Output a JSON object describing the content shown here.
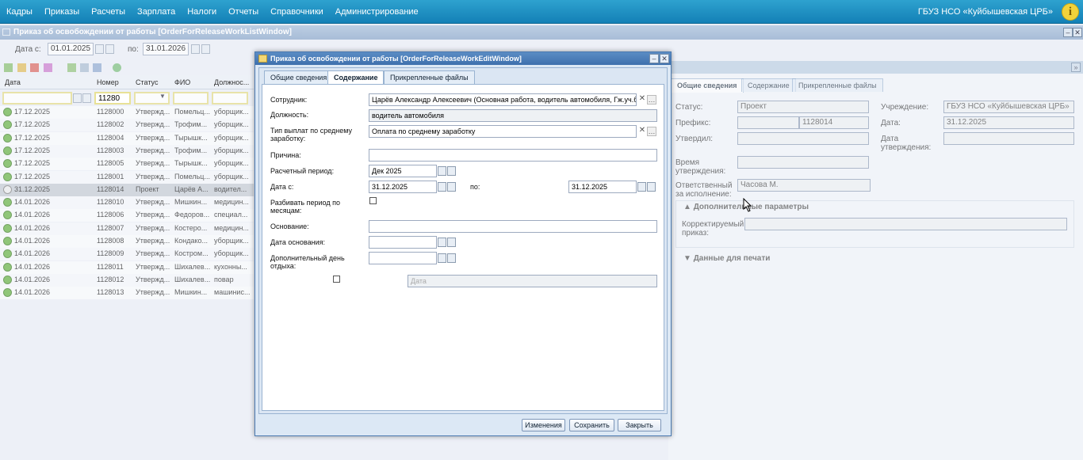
{
  "menu": [
    "Кадры",
    "Приказы",
    "Расчеты",
    "Зарплата",
    "Налоги",
    "Отчеты",
    "Справочники",
    "Администрирование"
  ],
  "org": "ГБУЗ НСО «Куйбышевская ЦРБ»",
  "info_icon": "i",
  "list_window": {
    "title": "Приказ об освобождении от работы [OrderForReleaseWorkListWindow]",
    "date_from_label": "Дата с:",
    "date_from": "01.01.2025",
    "date_to_label": "по:",
    "date_to": "31.01.2026",
    "columns": [
      "Дата",
      "Номер",
      "Статус",
      "ФИО",
      "Должнос..."
    ],
    "filter_number": "11280",
    "rows": [
      [
        "17.12.2025",
        "1128000",
        "Утвержд...",
        "Помельц...",
        "уборщик..."
      ],
      [
        "17.12.2025",
        "1128002",
        "Утвержд...",
        "Трофим...",
        "уборщик..."
      ],
      [
        "17.12.2025",
        "1128004",
        "Утвержд...",
        "Тырышк...",
        "уборщик..."
      ],
      [
        "17.12.2025",
        "1128003",
        "Утвержд...",
        "Трофим...",
        "уборщик..."
      ],
      [
        "17.12.2025",
        "1128005",
        "Утвержд...",
        "Тырышк...",
        "уборщик..."
      ],
      [
        "17.12.2025",
        "1128001",
        "Утвержд...",
        "Помельц...",
        "уборщик..."
      ],
      [
        "31.12.2025",
        "1128014",
        "Проект",
        "Царёв А...",
        "водител..."
      ],
      [
        "14.01.2026",
        "1128010",
        "Утвержд...",
        "Мишкин...",
        "медицин..."
      ],
      [
        "14.01.2026",
        "1128006",
        "Утвержд...",
        "Федоров...",
        "специал..."
      ],
      [
        "14.01.2026",
        "1128007",
        "Утвержд...",
        "Костеро...",
        "медицин..."
      ],
      [
        "14.01.2026",
        "1128008",
        "Утвержд...",
        "Кондако...",
        "уборщик..."
      ],
      [
        "14.01.2026",
        "1128009",
        "Утвержд...",
        "Костром...",
        "уборщик..."
      ],
      [
        "14.01.2026",
        "1128011",
        "Утвержд...",
        "Шихалев...",
        "кухонны..."
      ],
      [
        "14.01.2026",
        "1128012",
        "Утвержд...",
        "Шихалев...",
        "повар"
      ],
      [
        "14.01.2026",
        "1128013",
        "Утвержд...",
        "Мишкин...",
        "машинис..."
      ]
    ]
  },
  "detail": {
    "tabs": [
      "Общие сведения",
      "Содержание",
      "Прикрепленные файлы"
    ],
    "status_label": "Статус:",
    "status": "Проект",
    "institution_label": "Учреждение:",
    "institution": "ГБУЗ НСО «Куйбышевская ЦРБ»",
    "prefix_label": "Префикс:",
    "prefix_number": "1128014",
    "date_label": "Дата:",
    "date": "31.12.2025",
    "approved_label": "Утвердил:",
    "approval_date_label": "Дата утверждения:",
    "approval_time_label": "Время утверждения:",
    "responsible_label": "Ответственный за исполнение:",
    "responsible": "Часова М.",
    "extra_section": "Дополнительные параметры",
    "corrected_label": "Корректируемый приказ:",
    "print_section": "Данные для печати"
  },
  "dialog": {
    "title": "Приказ об освобождении от работы [OrderForReleaseWorkEditWindow]",
    "tabs": [
      "Общие сведения",
      "Содержание",
      "Прикрепленные файлы"
    ],
    "employee_label": "Сотрудник:",
    "employee": "Царёв Александр Алексеевич (Основная работа, водитель автомобиля, Гж.уч.б",
    "position_label": "Должность:",
    "position": "водитель автомобиля",
    "pay_type_label": "Тип выплат по среднему заработку:",
    "pay_type": "Оплата по среднему заработку",
    "reason_label": "Причина:",
    "period_label": "Расчетный период:",
    "period": "Дек 2025",
    "date_from_label": "Дата с:",
    "date_from": "31.12.2025",
    "date_to_label": "по:",
    "date_to": "31.12.2025",
    "split_label": "Разбивать период по месяцам:",
    "basis_label": "Основание:",
    "basis_date_label": "Дата основания:",
    "extra_day_label": "Дополнительный день отдыха:",
    "date_placeholder": "Дата",
    "btn_changes": "Изменения",
    "btn_save": "Сохранить",
    "btn_close": "Закрыть"
  }
}
